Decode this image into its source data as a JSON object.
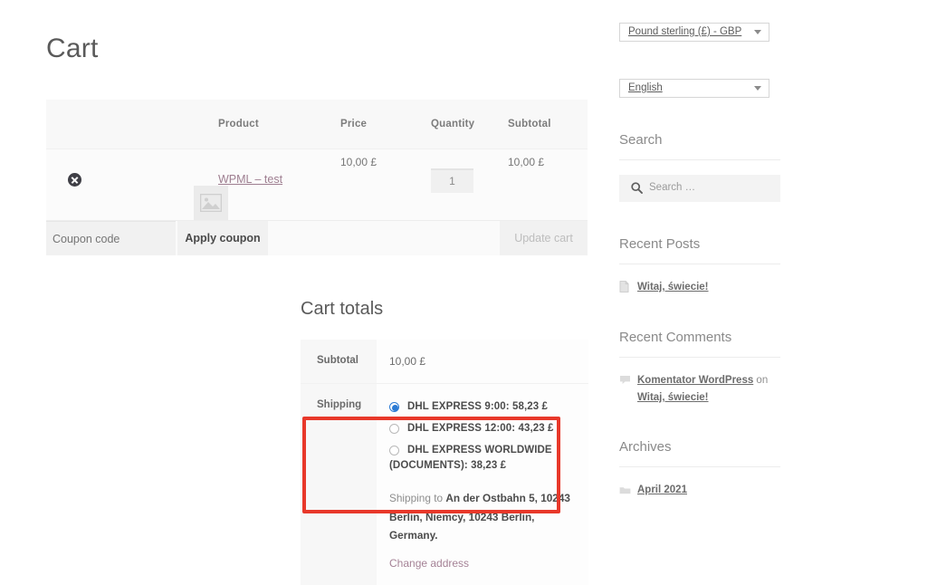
{
  "page": {
    "title": "Cart"
  },
  "cart_table": {
    "headers": {
      "remove": "",
      "thumbnail": "",
      "product": "Product",
      "price": "Price",
      "quantity": "Quantity",
      "subtotal": "Subtotal"
    },
    "rows": [
      {
        "remove_icon": "remove-item-icon",
        "thumbnail_icon": "placeholder-image-icon",
        "product_name": "WPML – test",
        "price": "10,00 £",
        "quantity": "1",
        "subtotal": "10,00 £"
      }
    ]
  },
  "coupon": {
    "placeholder": "Coupon code",
    "value": "",
    "apply_label": "Apply coupon",
    "update_label": "Update cart"
  },
  "cart_totals": {
    "title": "Cart totals",
    "subtotal_label": "Subtotal",
    "subtotal_value": "10,00 £",
    "shipping_label": "Shipping",
    "shipping_options": [
      {
        "label": "DHL EXPRESS 9:00: 58,23 £",
        "selected": true
      },
      {
        "label": "DHL EXPRESS 12:00: 43,23 £",
        "selected": false
      },
      {
        "label": "DHL EXPRESS WORLDWIDE",
        "selected": false
      }
    ],
    "shipping_option_3_continuation": "(DOCUMENTS): 38,23 £",
    "shipping_to_prefix": "Shipping to ",
    "shipping_address": "An der Ostbahn 5, 10243 Berlin, Niemcy, 10243 Berlin, Germany.",
    "change_address_label": "Change address",
    "highlight_color": "#e8382a"
  },
  "sidebar": {
    "currency_select": {
      "value": "Pound sterling (£) - GBP",
      "caret_icon": "chevron-down-icon"
    },
    "language_select": {
      "value": "English",
      "caret_icon": "chevron-down-icon"
    },
    "search_widget": {
      "title": "Search",
      "placeholder": "Search …",
      "value": "",
      "icon": "search-icon"
    },
    "recent_posts": {
      "title": "Recent Posts",
      "items": [
        {
          "icon": "document-icon",
          "label": "Witaj, świecie!"
        }
      ]
    },
    "recent_comments": {
      "title": "Recent Comments",
      "items": [
        {
          "icon": "comment-bubble-icon",
          "author": "Komentator WordPress",
          "connector": " on ",
          "post": "Witaj, świecie!"
        }
      ]
    },
    "archives": {
      "title": "Archives",
      "items": [
        {
          "icon": "folder-icon",
          "label": "April 2021"
        }
      ]
    }
  }
}
